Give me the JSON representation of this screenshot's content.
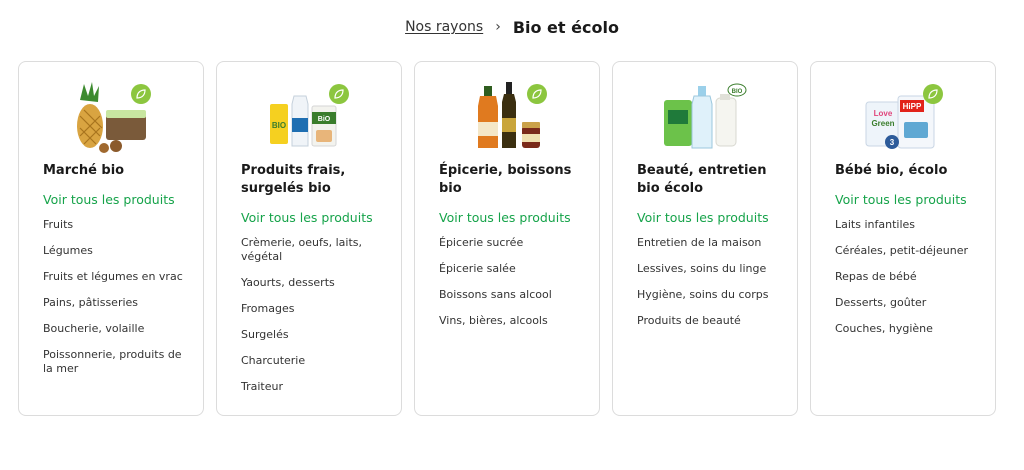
{
  "breadcrumb": {
    "parent": "Nos rayons",
    "separator": "›",
    "current": "Bio et écolo"
  },
  "colors": {
    "accent_green": "#16a34a",
    "badge_green": "#8cc63f",
    "border": "#dcdcdc"
  },
  "categories": [
    {
      "title": "Marché bio",
      "see_all": "Voir tous les produits",
      "image_icon": "pineapple-and-produce-icon",
      "items": [
        "Fruits",
        "Légumes",
        "Fruits et légumes en vrac",
        "Pains, pâtisseries",
        "Boucherie, volaille",
        "Poissonnerie, produits de la mer"
      ]
    },
    {
      "title": "Produits frais, surgelés bio",
      "see_all": "Voir tous les produits",
      "image_icon": "dairy-products-icon",
      "items": [
        "Crèmerie, oeufs, laits, végétal",
        "Yaourts, desserts",
        "Fromages",
        "Surgelés",
        "Charcuterie",
        "Traiteur"
      ]
    },
    {
      "title": "Épicerie, boissons bio",
      "see_all": "Voir tous les produits",
      "image_icon": "juice-oil-jar-icon",
      "items": [
        "Épicerie sucrée",
        "Épicerie salée",
        "Boissons sans alcool",
        "Vins, bières, alcools"
      ]
    },
    {
      "title": "Beauté, entretien bio écolo",
      "see_all": "Voir tous les produits",
      "image_icon": "cleaning-products-icon",
      "items": [
        "Entretien de la maison",
        "Lessives, soins du linge",
        "Hygiène, soins du corps",
        "Produits de beauté"
      ]
    },
    {
      "title": "Bébé bio, écolo",
      "see_all": "Voir tous les produits",
      "image_icon": "baby-food-icon",
      "items": [
        "Laits infantiles",
        "Céréales, petit-déjeuner",
        "Repas de bébé",
        "Desserts, goûter",
        "Couches, hygiène"
      ]
    }
  ]
}
